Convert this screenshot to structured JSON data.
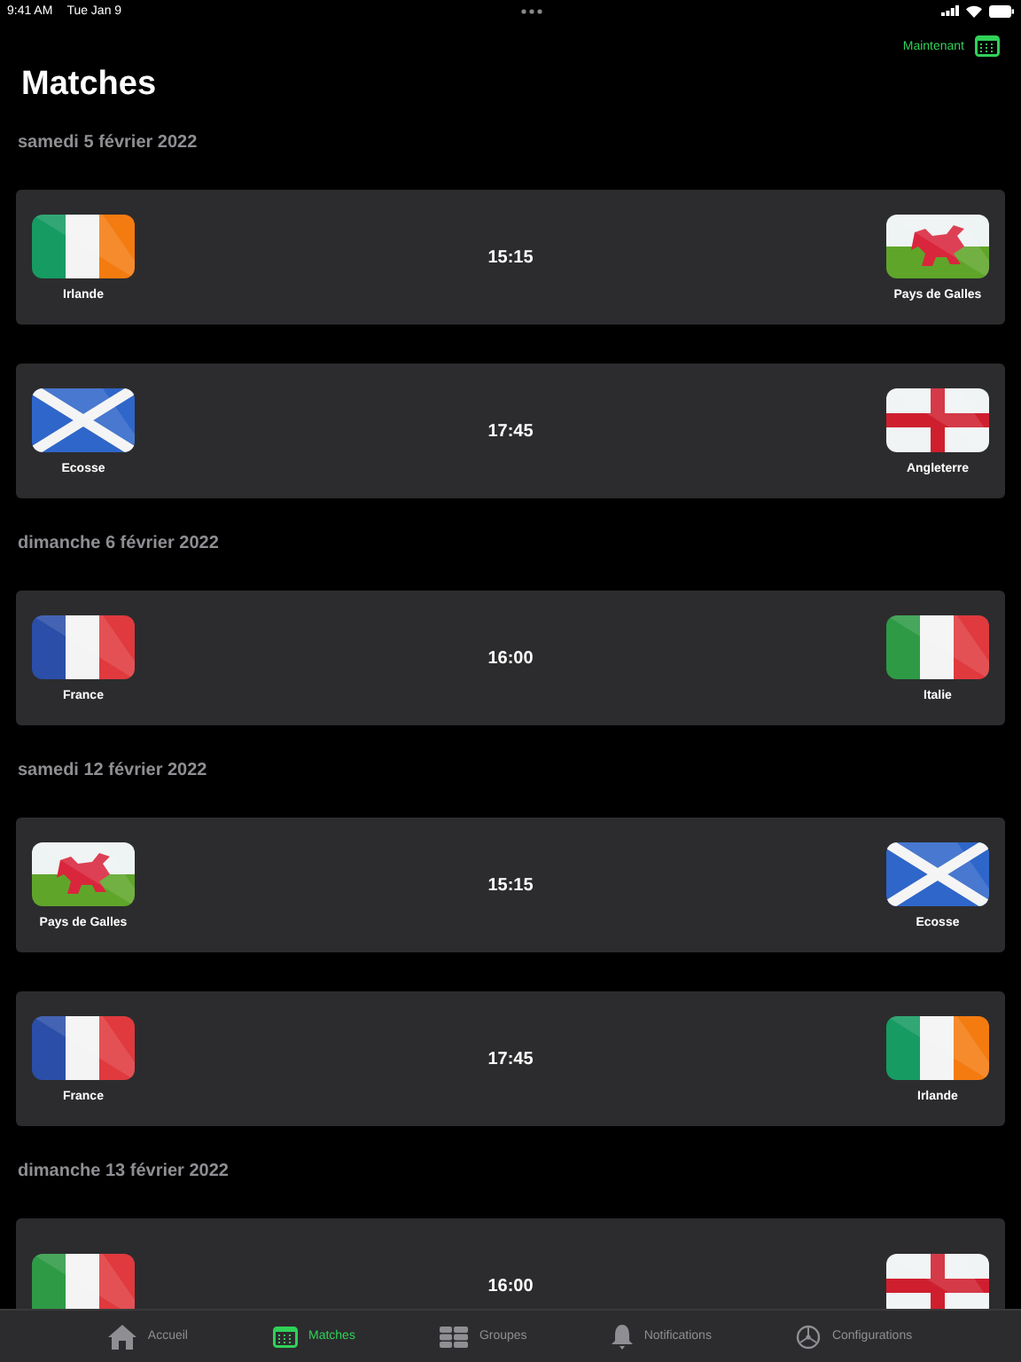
{
  "status_bar": {
    "time": "9:41 AM",
    "date": "Tue Jan 9"
  },
  "nav": {
    "action": "Maintenant"
  },
  "title": "Matches",
  "sections": [
    {
      "date": "samedi 5 février 2022",
      "matches": [
        {
          "time": "15:15",
          "home": {
            "name": "Irlande",
            "kind": "ireland"
          },
          "away": {
            "name": "Pays de Galles",
            "kind": "wales"
          }
        },
        {
          "time": "17:45",
          "home": {
            "name": "Ecosse",
            "kind": "scotland"
          },
          "away": {
            "name": "Angleterre",
            "kind": "england"
          }
        }
      ]
    },
    {
      "date": "dimanche 6 février 2022",
      "matches": [
        {
          "time": "16:00",
          "home": {
            "name": "France",
            "kind": "france"
          },
          "away": {
            "name": "Italie",
            "kind": "italy"
          }
        }
      ]
    },
    {
      "date": "samedi 12 février 2022",
      "matches": [
        {
          "time": "15:15",
          "home": {
            "name": "Pays de Galles",
            "kind": "wales"
          },
          "away": {
            "name": "Ecosse",
            "kind": "scotland"
          }
        },
        {
          "time": "17:45",
          "home": {
            "name": "France",
            "kind": "france"
          },
          "away": {
            "name": "Irlande",
            "kind": "ireland"
          }
        }
      ]
    },
    {
      "date": "dimanche 13 février 2022",
      "matches": [
        {
          "time": "16:00",
          "home": {
            "kind": "italy"
          },
          "away": {
            "kind": "england"
          }
        }
      ]
    }
  ],
  "tab_bar": [
    {
      "label": "Accueil",
      "kind": "home",
      "selected": false
    },
    {
      "label": "Matches",
      "kind": "calendar",
      "selected": true
    },
    {
      "label": "Groupes",
      "kind": "table",
      "selected": false
    },
    {
      "label": "Notifications",
      "kind": "bell",
      "selected": false
    },
    {
      "label": "Configurations",
      "kind": "gear",
      "selected": false
    }
  ]
}
